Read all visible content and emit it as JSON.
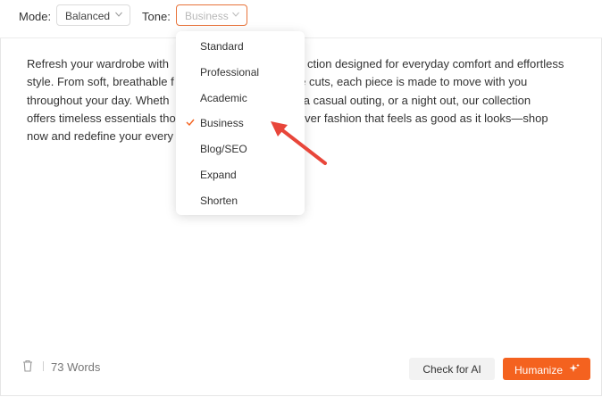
{
  "toolbar": {
    "mode_label": "Mode:",
    "mode_value": "Balanced",
    "tone_label": "Tone:",
    "tone_value": "Business"
  },
  "content": {
    "visible_lines": [
      "Refresh your wardrobe with",
      "ction designed for everyday comfort and effortless",
      "style. From soft, breathable f",
      "tile cuts, each piece is made to move with you",
      "throughout your day. Wheth",
      "ork, a casual outing, or a night out, our collection",
      "offers timeless essentials tho",
      "Discover fashion that feels as good as it looks—shop",
      "now and redefine your every"
    ]
  },
  "tone_menu": {
    "items": [
      "Standard",
      "Professional",
      "Academic",
      "Business",
      "Blog/SEO",
      "Expand",
      "Shorten"
    ],
    "selected": "Business"
  },
  "footer": {
    "word_count": "73 Words",
    "check_button": "Check for AI",
    "humanize_button": "Humanize"
  },
  "colors": {
    "accent": "#f4621f",
    "arrow": "#e8463a"
  },
  "icons": {
    "trash": "trash-icon",
    "sparkle": "sparkle-icon",
    "check": "check-icon",
    "chevron": "chevron-down-icon"
  }
}
